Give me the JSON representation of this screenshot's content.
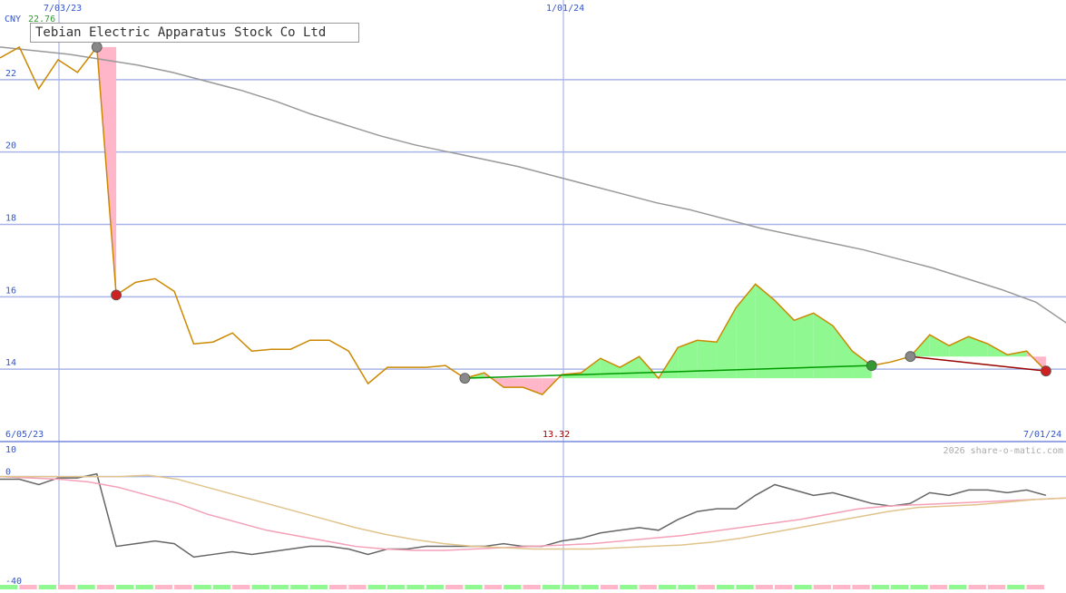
{
  "chart_data": [
    {
      "type": "line",
      "title": "Tebian Electric Apparatus Stock Co Ltd",
      "currency": "CNY",
      "last_price": "22.76",
      "low_label": "13.32",
      "ylim": [
        12,
        23.8
      ],
      "yticks": [
        "22",
        "20",
        "18",
        "16",
        "14"
      ],
      "x_top_labels": [
        "7/03/23",
        "1/01/24"
      ],
      "x_bottom_labels": [
        "6/05/23",
        "7/01/24"
      ],
      "dates": [
        "2023-06-05",
        "2023-06-12",
        "2023-06-19",
        "2023-06-26",
        "2023-07-03",
        "2023-07-10",
        "2023-07-17",
        "2023-07-24",
        "2023-07-31",
        "2023-08-07",
        "2023-08-14",
        "2023-08-21",
        "2023-08-28",
        "2023-09-04",
        "2023-09-11",
        "2023-09-18",
        "2023-09-25",
        "2023-10-02",
        "2023-10-09",
        "2023-10-16",
        "2023-10-23",
        "2023-10-30",
        "2023-11-06",
        "2023-11-13",
        "2023-11-20",
        "2023-11-27",
        "2023-12-04",
        "2023-12-11",
        "2023-12-18",
        "2023-12-25",
        "2024-01-01",
        "2024-01-08",
        "2024-01-15",
        "2024-01-22",
        "2024-01-29",
        "2024-02-05",
        "2024-02-12",
        "2024-02-19",
        "2024-02-26",
        "2024-03-04",
        "2024-03-11",
        "2024-03-18",
        "2024-03-25",
        "2024-04-01",
        "2024-04-08",
        "2024-04-15",
        "2024-04-22",
        "2024-04-29",
        "2024-05-06",
        "2024-05-13",
        "2024-05-20",
        "2024-05-27",
        "2024-06-03",
        "2024-06-10",
        "2024-06-17",
        "2024-06-24",
        "2024-07-01"
      ],
      "series": [
        {
          "role": "price",
          "color": "#cc8800",
          "values": [
            22.6,
            22.9,
            21.75,
            22.55,
            22.2,
            22.9,
            16.05,
            16.4,
            16.5,
            16.15,
            14.7,
            14.75,
            15.0,
            14.5,
            14.55,
            14.55,
            14.8,
            14.8,
            14.5,
            13.6,
            14.05,
            14.05,
            14.05,
            14.1,
            13.75,
            13.9,
            13.5,
            13.5,
            13.3,
            13.85,
            13.9,
            14.3,
            14.05,
            14.35,
            13.75,
            14.6,
            14.8,
            14.75,
            15.7,
            16.35,
            15.9,
            15.35,
            15.55,
            15.2,
            14.5,
            14.1,
            14.2,
            14.35,
            14.95,
            14.65,
            14.9,
            14.7,
            14.4,
            14.5,
            13.95
          ]
        },
        {
          "role": "moving-average",
          "color": "#999999",
          "values": [
            22.9,
            22.8,
            22.7,
            22.55,
            22.4,
            22.2,
            21.95,
            21.7,
            21.4,
            21.05,
            20.75,
            20.45,
            20.2,
            20.0,
            19.8,
            19.6,
            19.35,
            19.1,
            18.85,
            18.6,
            18.4,
            18.15,
            17.9,
            17.7,
            17.5,
            17.3,
            17.05,
            16.8,
            16.5,
            16.2,
            15.85,
            15.2
          ]
        }
      ],
      "trend_lines": [
        {
          "color": "#009900",
          "from": [
            13.75
          ],
          "to": [
            14.1
          ],
          "direction": "up"
        },
        {
          "color": "#990000",
          "from": [
            14.35
          ],
          "to": [
            13.95
          ],
          "direction": "down"
        }
      ],
      "markers": [
        {
          "price": 22.9,
          "color": "#888888"
        },
        {
          "price": 16.05,
          "color": "#cc2222"
        },
        {
          "price": 13.75,
          "color": "#888888"
        },
        {
          "price": 14.1,
          "color": "#339933"
        },
        {
          "price": 14.35,
          "color": "#888888"
        },
        {
          "price": 13.95,
          "color": "#cc2222"
        }
      ]
    },
    {
      "type": "line",
      "role": "oscillator",
      "ylim": [
        -40,
        10
      ],
      "yticks": [
        "10",
        "0",
        "-40"
      ],
      "watermark": "2026 share-o-matic.com",
      "series": [
        {
          "color": "#666666",
          "values": [
            -1,
            -1,
            -3,
            -0.5,
            -0.5,
            1,
            -26,
            -25,
            -24,
            -25,
            -30,
            -29,
            -28,
            -29,
            -28,
            -27,
            -26,
            -26,
            -27,
            -29,
            -27,
            -27,
            -26,
            -26,
            -26,
            -26,
            -25,
            -26,
            -26,
            -24,
            -23,
            -21,
            -20,
            -19,
            -20,
            -16,
            -13,
            -12,
            -12,
            -7,
            -3,
            -5,
            -7,
            -6,
            -8,
            -10,
            -11,
            -10,
            -6,
            -7,
            -5,
            -5,
            -6,
            -5,
            -7
          ]
        },
        {
          "color": "#f4a0b8",
          "values": [
            0,
            -0.5,
            -1,
            -2,
            -4,
            -7,
            -10,
            -14,
            -17,
            -20,
            -22,
            -24,
            -26,
            -27,
            -27.5,
            -27.5,
            -27,
            -26.5,
            -26,
            -25.5,
            -25,
            -24,
            -23,
            -22,
            -20.5,
            -19,
            -17.5,
            -16,
            -14,
            -12,
            -11,
            -10.5,
            -10,
            -9.5,
            -9,
            -8.5,
            -8
          ]
        },
        {
          "color": "#e0c48c",
          "values": [
            0,
            0,
            0,
            0,
            0,
            0.5,
            -1,
            -4,
            -7,
            -10,
            -13,
            -16,
            -19,
            -21.5,
            -23.5,
            -25,
            -26,
            -26.5,
            -27,
            -27,
            -27,
            -26.5,
            -26,
            -25.5,
            -24.5,
            -23,
            -21,
            -19,
            -17,
            -15,
            -13,
            -11.5,
            -11,
            -10.5,
            -9.5,
            -8.5,
            -8
          ]
        }
      ]
    }
  ]
}
